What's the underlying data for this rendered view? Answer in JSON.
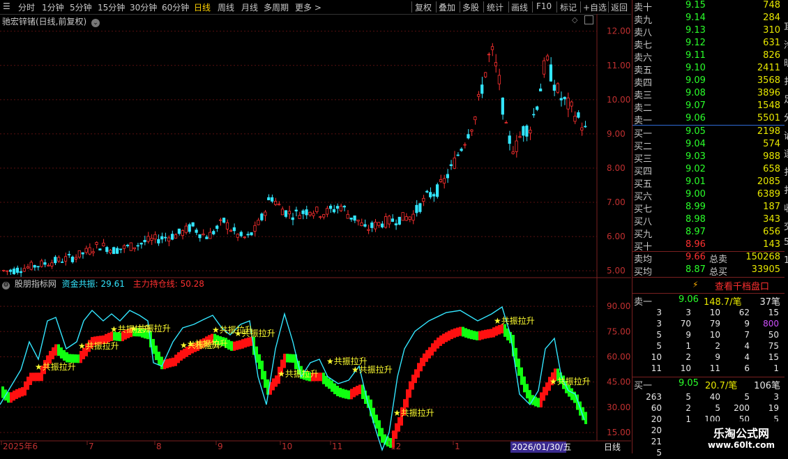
{
  "toolbar": {
    "periods": [
      "分时",
      "1分钟",
      "5分钟",
      "15分钟",
      "30分钟",
      "60分钟",
      "日线",
      "周线",
      "月线",
      "多周期",
      "更多 >"
    ],
    "active_period": "日线",
    "actions": [
      "复权",
      "叠加",
      "多股",
      "统计",
      "画线",
      "F10",
      "标记",
      "+自选",
      "返回"
    ]
  },
  "stock_title": "驰宏锌锗(日线,前复权)",
  "price_axis": [
    "12.00",
    "11.00",
    "10.00",
    "9.00",
    "8.00",
    "7.00",
    "6.00",
    "5.00"
  ],
  "indicator": {
    "name": "股朋指标网",
    "line1_label": "资金共振: 29.61",
    "line2_label": "主力持仓线: 50.28",
    "axis": [
      "90.00",
      "75.00",
      "60.00",
      "45.00",
      "30.00",
      "15.00"
    ],
    "signal_text": "共振拉升",
    "colors": {
      "cyan": "#33e6ff",
      "red": "#ff1010",
      "green": "#10ff10",
      "yellow": "#ffff30"
    }
  },
  "date_axis": {
    "labels": [
      "2025年6",
      "7",
      "8",
      "9",
      "10",
      "11",
      "12",
      "1"
    ],
    "highlight": "2026/01/30/五",
    "period_label": "日线"
  },
  "chart_data": {
    "type": "candlestick",
    "title": "驰宏锌锗(日线,前复权)",
    "ylim": [
      4.8,
      12.3
    ],
    "series": [
      {
        "name": "close",
        "values": [
          5.0,
          5.0,
          5.05,
          5.1,
          5.15,
          5.2,
          5.25,
          5.3,
          5.35,
          5.4,
          5.5,
          5.6,
          5.75,
          5.7,
          5.6,
          5.65,
          5.7,
          5.75,
          5.85,
          5.9,
          5.95,
          6.0,
          6.05,
          6.15,
          6.3,
          6.1,
          6.0,
          6.2,
          6.45,
          6.2,
          6.0,
          5.95,
          6.2,
          6.6,
          7.2,
          6.9,
          6.7,
          6.65,
          6.7,
          6.8,
          6.7,
          6.7,
          6.8,
          6.9,
          6.6,
          6.5,
          6.2,
          6.3,
          6.4,
          6.45,
          6.5,
          6.55,
          6.6,
          6.9,
          7.2,
          7.3,
          7.6,
          8.0,
          8.5,
          9.0,
          9.5,
          10.5,
          11.5,
          10.6,
          9.0,
          8.5,
          9.1,
          9.2,
          10.0,
          11.2,
          10.5,
          10.0,
          9.8,
          9.5,
          9.1
        ]
      }
    ]
  },
  "order_book": {
    "asks": [
      {
        "label": "卖十",
        "price": "9.15",
        "vol": "748"
      },
      {
        "label": "卖九",
        "price": "9.14",
        "vol": "284"
      },
      {
        "label": "卖八",
        "price": "9.13",
        "vol": "310"
      },
      {
        "label": "卖七",
        "price": "9.12",
        "vol": "631"
      },
      {
        "label": "卖六",
        "price": "9.11",
        "vol": "826"
      },
      {
        "label": "卖五",
        "price": "9.10",
        "vol": "2411"
      },
      {
        "label": "卖四",
        "price": "9.09",
        "vol": "3568"
      },
      {
        "label": "卖三",
        "price": "9.08",
        "vol": "3896"
      },
      {
        "label": "卖二",
        "price": "9.07",
        "vol": "1548"
      },
      {
        "label": "卖一",
        "price": "9.06",
        "vol": "5501"
      }
    ],
    "bids": [
      {
        "label": "买一",
        "price": "9.05",
        "vol": "2198"
      },
      {
        "label": "买二",
        "price": "9.04",
        "vol": "574"
      },
      {
        "label": "买三",
        "price": "9.03",
        "vol": "988"
      },
      {
        "label": "买四",
        "price": "9.02",
        "vol": "658"
      },
      {
        "label": "买五",
        "price": "9.01",
        "vol": "2085"
      },
      {
        "label": "买六",
        "price": "9.00",
        "vol": "6389"
      },
      {
        "label": "买七",
        "price": "8.99",
        "vol": "187"
      },
      {
        "label": "买八",
        "price": "8.98",
        "vol": "343"
      },
      {
        "label": "买九",
        "price": "8.97",
        "vol": "656"
      },
      {
        "label": "买十",
        "price": "8.96",
        "vol": "143"
      }
    ],
    "ask_avg": {
      "label": "卖均",
      "price": "9.66",
      "total_label": "总卖",
      "total": "150268"
    },
    "bid_avg": {
      "label": "买均",
      "price": "8.87",
      "total_label": "总买",
      "total": "33905"
    },
    "view_1000_button": "查看千档盘口",
    "ask1_detail": {
      "label": "卖一",
      "price": "9.06",
      "amount": "148.7/笔",
      "count": "37笔"
    },
    "ask_queue": [
      [
        "3",
        "3",
        "10",
        "62",
        "15"
      ],
      [
        "3",
        "70",
        "79",
        "9",
        "800"
      ],
      [
        "5",
        "9",
        "10",
        "7",
        "50"
      ],
      [
        "5",
        "1",
        "2",
        "4",
        "75"
      ],
      [
        "10",
        "2",
        "9",
        "4",
        "15"
      ],
      [
        "11",
        "10",
        "11",
        "6",
        "1"
      ]
    ],
    "bid1_detail": {
      "label": "买一",
      "price": "9.05",
      "amount": "20.7/笔",
      "count": "106笔"
    },
    "bid_queue": [
      [
        "263",
        "5",
        "40",
        "5",
        "3"
      ],
      [
        "60",
        "2",
        "5",
        "200",
        "19"
      ],
      [
        "20",
        "1",
        "100",
        "50",
        "5"
      ],
      [
        "20",
        "",
        "",
        "",
        ""
      ],
      [
        "21",
        "",
        "",
        "",
        ""
      ],
      [
        "5",
        "",
        "",
        "",
        ""
      ]
    ]
  },
  "side_chars": [
    "耳",
    "泠",
    "昕",
    "扌",
    "足",
    "分",
    "谄",
    "逐",
    "扌",
    "扌",
    "收",
    "交",
    "5",
    "1"
  ],
  "brand": {
    "name": "乐淘公式网",
    "url": "www.60lt.com"
  }
}
